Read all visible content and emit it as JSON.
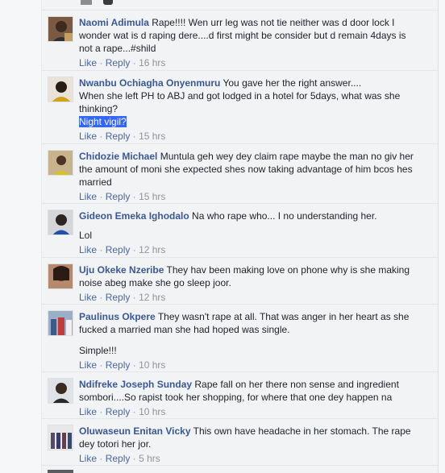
{
  "comments": [
    {
      "author": "Naomi Adimula",
      "text": "Rape!!!! Wen urr leg was not tie neither was d door lock I wonder wat is d raping dere....d first might be consider but d remain 4days is not a rape...#shild",
      "like": "Like",
      "reply": "Reply",
      "time": "16 hrs"
    },
    {
      "author": "Nwanbu Ochiagha Onyenmuru",
      "text": "You gave her the right answer....",
      "text2": "When she left PH to ABJ and got lodged in a hotel for 5days, what was she thinking?",
      "highlight": "Night vigil?",
      "like": "Like",
      "reply": "Reply",
      "time": "15 hrs"
    },
    {
      "author": "Chidozie Michael",
      "text": "Muntula geh wey dey claim rape maybe the man no giv her the amount of moni she expected shes now taking advantage of him bcos hes married",
      "like": "Like",
      "reply": "Reply",
      "time": "15 hrs"
    },
    {
      "author": "Gideon Emeka Ighodalo",
      "text": "Na who rape who... I no understanding her.",
      "text2": "Lol",
      "like": "Like",
      "reply": "Reply",
      "time": "12 hrs"
    },
    {
      "author": "Uju Okeke Nzeribe",
      "text": "They hav been making love on phone why is she making noise abeg make she go sleep joor.",
      "like": "Like",
      "reply": "Reply",
      "time": "12 hrs"
    },
    {
      "author": "Paulinus Okpere",
      "text": "They wasn't rape at all. That was anger in her heart as she fucked a married man she had hoped was single.",
      "text2": "Simple!!!",
      "like": "Like",
      "reply": "Reply",
      "time": "10 hrs"
    },
    {
      "author": "Ndifreke Joseph Sunday",
      "text": "Rape fall on her there non sense and ingredient sombori....So rapist took her shopping, for where that one dey happen na",
      "like": "Like",
      "reply": "Reply",
      "time": "10 hrs"
    },
    {
      "author": "Oluwaseun Enitan Vicky",
      "text": "This own have headache in her stomach. The rape dey totori her jor.",
      "like": "Like",
      "reply": "Reply",
      "time": "5 hrs"
    }
  ]
}
